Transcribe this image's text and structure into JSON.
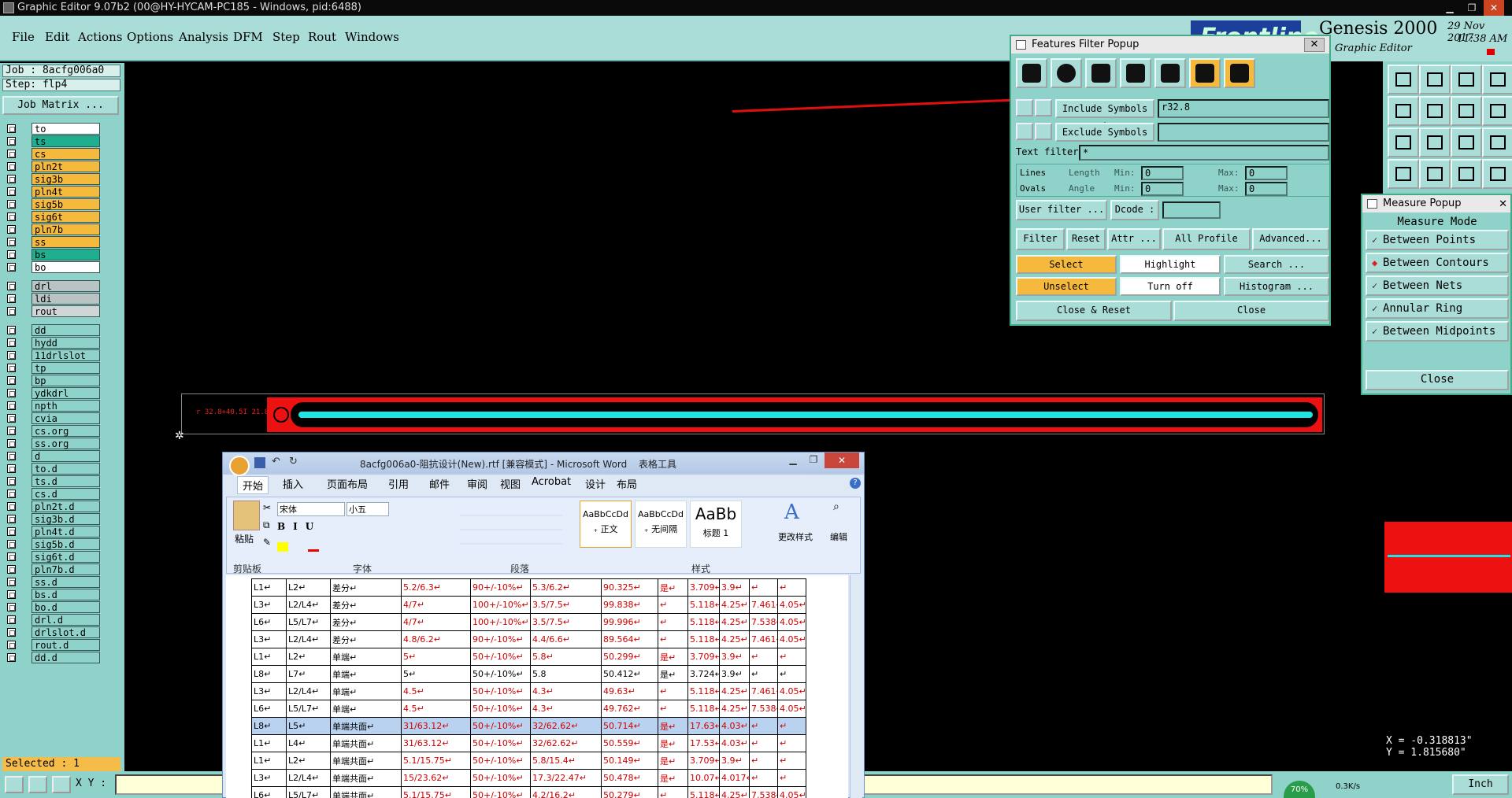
{
  "window": {
    "title": "Graphic Editor 9.07b2 (00@HY-HYCAM-PC185 - Windows, pid:6488)"
  },
  "menu": [
    "File",
    "Edit",
    "Actions",
    "Options",
    "Analysis",
    "DFM",
    "Step",
    "Rout",
    "Windows"
  ],
  "brand": {
    "name": "Genesis 2000",
    "sub": "Graphic Editor",
    "date": "29 Nov 2017",
    "time": "11:38 AM"
  },
  "job": {
    "job": "Job : 8acfg006a0",
    "step": "Step: flp4",
    "matrix": "Job Matrix ..."
  },
  "layers": [
    {
      "n": "to",
      "c": "#ffffff"
    },
    {
      "n": "ts",
      "c": "#1fae8e"
    },
    {
      "n": "cs",
      "c": "#f5b93e"
    },
    {
      "n": "pln2t",
      "c": "#f5b93e"
    },
    {
      "n": "sig3b",
      "c": "#f5b93e"
    },
    {
      "n": "pln4t",
      "c": "#f5b93e"
    },
    {
      "n": "sig5b",
      "c": "#f5b93e"
    },
    {
      "n": "sig6t",
      "c": "#f5b93e"
    },
    {
      "n": "pln7b",
      "c": "#f5b93e"
    },
    {
      "n": "ss",
      "c": "#f5b93e"
    },
    {
      "n": "bs",
      "c": "#1fae8e"
    },
    {
      "n": "bo",
      "c": "#ffffff"
    },
    {
      "n": "drl",
      "c": "#b9c3c3"
    },
    {
      "n": "ldi",
      "c": "#b9c3c3"
    },
    {
      "n": "rout",
      "c": "#d0d6d6"
    },
    {
      "n": "dd",
      "c": "#8fd2c9"
    },
    {
      "n": "hydd",
      "c": "#8fd2c9"
    },
    {
      "n": "11drlslot",
      "c": "#8fd2c9"
    },
    {
      "n": "tp",
      "c": "#8fd2c9"
    },
    {
      "n": "bp",
      "c": "#8fd2c9"
    },
    {
      "n": "ydkdrl",
      "c": "#8fd2c9"
    },
    {
      "n": "npth",
      "c": "#8fd2c9"
    },
    {
      "n": "cvia",
      "c": "#8fd2c9"
    },
    {
      "n": "cs.org",
      "c": "#8fd2c9"
    },
    {
      "n": "ss.org",
      "c": "#8fd2c9"
    },
    {
      "n": "d",
      "c": "#8fd2c9"
    },
    {
      "n": "to.d",
      "c": "#8fd2c9"
    },
    {
      "n": "ts.d",
      "c": "#8fd2c9"
    },
    {
      "n": "cs.d",
      "c": "#8fd2c9"
    },
    {
      "n": "pln2t.d",
      "c": "#8fd2c9"
    },
    {
      "n": "sig3b.d",
      "c": "#8fd2c9"
    },
    {
      "n": "pln4t.d",
      "c": "#8fd2c9"
    },
    {
      "n": "sig5b.d",
      "c": "#8fd2c9"
    },
    {
      "n": "sig6t.d",
      "c": "#8fd2c9"
    },
    {
      "n": "pln7b.d",
      "c": "#8fd2c9"
    },
    {
      "n": "ss.d",
      "c": "#8fd2c9"
    },
    {
      "n": "bs.d",
      "c": "#8fd2c9"
    },
    {
      "n": "bo.d",
      "c": "#8fd2c9"
    },
    {
      "n": "drl.d",
      "c": "#8fd2c9"
    },
    {
      "n": "drlslot.d",
      "c": "#8fd2c9"
    },
    {
      "n": "rout.d",
      "c": "#8fd2c9"
    },
    {
      "n": "dd.d",
      "c": "#8fd2c9"
    }
  ],
  "status": {
    "selected": "Selected : 1",
    "xy_label": "X Y :",
    "x": "X = -0.318813\"",
    "y": "Y = 1.815680\"",
    "unit": "Inch",
    "net": "0.3K/s",
    "pct": "70%"
  },
  "features_popup": {
    "title": "Features Filter Popup",
    "include_label": "Include Symbols :",
    "include_value": "r32.8",
    "exclude_label": "Exclude Symbols :",
    "text_filter_label": "Text filter",
    "text_filter_value": "*",
    "lines": "Lines",
    "ovals": "Ovals",
    "length": "Length",
    "angle": "Angle",
    "min": "Min:",
    "max": "Max:",
    "zero": "0",
    "user_filter": "User filter ...",
    "dcode": "Dcode :",
    "filter": "Filter",
    "reset": "Reset",
    "attr": "Attr ...",
    "all_profile": "All Profile",
    "advanced": "Advanced...",
    "select": "Select",
    "highlight": "Highlight",
    "search": "Search ...",
    "unselect": "Unselect",
    "turn_off": "Turn off",
    "histogram": "Histogram ...",
    "close_reset": "Close & Reset",
    "close": "Close"
  },
  "measure_popup": {
    "title": "Measure Popup",
    "mode": "Measure Mode",
    "items": [
      "Between Points",
      "Between Contours",
      "Between Nets",
      "Annular Ring",
      "Between Midpoints"
    ],
    "close": "Close"
  },
  "board_text": "r 32.8+40.5I 21.8",
  "word": {
    "title": "8acfg006a0-阻抗设计(New).rtf [兼容模式] - Microsoft Word",
    "tools": "表格工具",
    "tabs": [
      "开始",
      "插入",
      "页面布局",
      "引用",
      "邮件",
      "审阅",
      "视图",
      "Acrobat",
      "设计",
      "布局"
    ],
    "font": "宋体",
    "size": "小五",
    "paste": "粘贴",
    "groups": [
      "剪贴板",
      "字体",
      "段落",
      "样式",
      "编辑"
    ],
    "styles": [
      {
        "s": "AaBbCcDd",
        "n": "₊ 正文"
      },
      {
        "s": "AaBbCcDd",
        "n": "₊ 无间隔"
      },
      {
        "s": "AaBb",
        "n": "标题 1"
      }
    ],
    "change_style": "更改样式",
    "edit": "编辑",
    "rows": [
      [
        "L1↵",
        "L2↵",
        "差分↵",
        "5.2/6.3↵",
        "90+/-10%↵",
        "5.3/6.2↵",
        "90.325↵",
        "是↵",
        "3.709↵",
        "3.9↵",
        "↵",
        "↵"
      ],
      [
        "L3↵",
        "L2/L4↵",
        "差分↵",
        "4/7↵",
        "100+/-10%↵",
        "3.5/7.5↵",
        "99.838↵",
        "↵",
        "5.118↵",
        "4.25↵",
        "7.461↵",
        "4.05↵"
      ],
      [
        "L6↵",
        "L5/L7↵",
        "差分↵",
        "4/7↵",
        "100+/-10%↵",
        "3.5/7.5↵",
        "99.996↵",
        "↵",
        "5.118↵",
        "4.25↵",
        "7.538↵",
        "4.05↵"
      ],
      [
        "L3↵",
        "L2/L4↵",
        "差分↵",
        "4.8/6.2↵",
        "90+/-10%↵",
        "4.4/6.6↵",
        "89.564↵",
        "↵",
        "5.118↵",
        "4.25↵",
        "7.461↵",
        "4.05↵"
      ],
      [
        "L1↵",
        "L2↵",
        "单端↵",
        "5↵",
        "50+/-10%↵",
        "5.8↵",
        "50.299↵",
        "是↵",
        "3.709↵",
        "3.9↵",
        "↵",
        "↵"
      ],
      [
        "L8↵",
        "L7↵",
        "单端↵",
        "5↵",
        "50+/-10%↵",
        "5.8",
        "50.412↵",
        "是↵",
        "3.724↵",
        "3.9↵",
        "↵",
        "↵"
      ],
      [
        "L3↵",
        "L2/L4↵",
        "单端↵",
        "4.5↵",
        "50+/-10%↵",
        "4.3↵",
        "49.63↵",
        "↵",
        "5.118↵",
        "4.25↵",
        "7.461↵",
        "4.05↵"
      ],
      [
        "L6↵",
        "L5/L7↵",
        "单端↵",
        "4.5↵",
        "50+/-10%↵",
        "4.3↵",
        "49.762↵",
        "↵",
        "5.118↵",
        "4.25↵",
        "7.538↵",
        "4.05↵"
      ],
      [
        "L8↵",
        "L5↵",
        "单端共面↵",
        "31/63.12↵",
        "50+/-10%↵",
        "32/62.62↵",
        "50.714↵",
        "是↵",
        "17.63↵",
        "4.03↵",
        "↵",
        "↵"
      ],
      [
        "L1↵",
        "L4↵",
        "单端共面↵",
        "31/63.12↵",
        "50+/-10%↵",
        "32/62.62↵",
        "50.559↵",
        "是↵",
        "17.53↵",
        "4.03↵",
        "↵",
        "↵"
      ],
      [
        "L1↵",
        "L2↵",
        "单端共面↵",
        "5.1/15.75↵",
        "50+/-10%↵",
        "5.8/15.4↵",
        "50.149↵",
        "是↵",
        "3.709↵",
        "3.9↵",
        "↵",
        "↵"
      ],
      [
        "L3↵",
        "L2/L4↵",
        "单端共面↵",
        "15/23.62↵",
        "50+/-10%↵",
        "17.3/22.47↵",
        "50.478↵",
        "是↵",
        "10.07↵",
        "4.017↵",
        "↵",
        "↵"
      ],
      [
        "L6↵",
        "L5/L7↵",
        "单端共面↵",
        "5.1/15.75↵",
        "50+/-10%↵",
        "4.2/16.2↵",
        "50.279↵",
        "↵",
        "5.118↵",
        "4.25↵",
        "7.538↵",
        "4.05↵"
      ]
    ]
  }
}
